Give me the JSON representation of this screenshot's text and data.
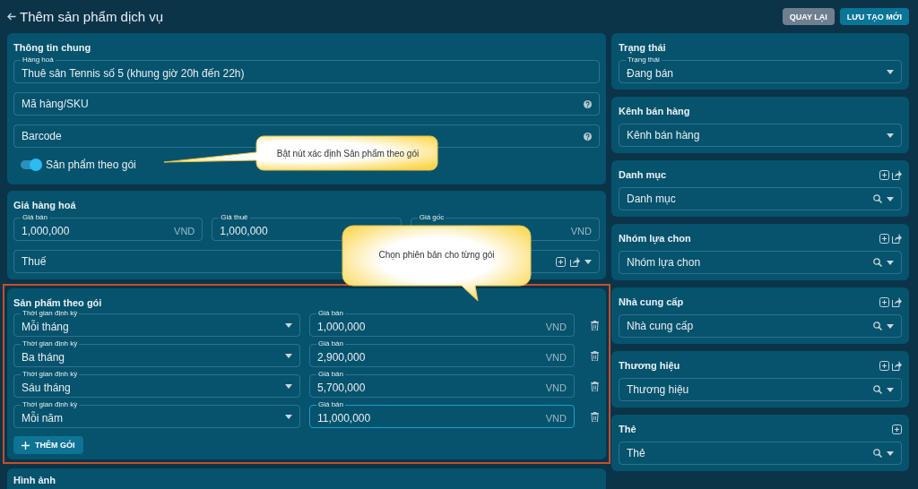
{
  "header": {
    "title": "Thêm sản phẩm dịch vụ",
    "buttons": [
      {
        "label": "QUAY LẠI",
        "kind": "secondary"
      },
      {
        "label": "LƯU TẠO MỚI",
        "kind": "primary"
      }
    ]
  },
  "general": {
    "title": "Thông tin chung",
    "fields": [
      {
        "label": "Hàng hoá",
        "value": "Thuê sân Tennis số 5 (khung giờ 20h đến 22h)"
      },
      {
        "placeholder": "Mã hàng/SKU",
        "help": true
      },
      {
        "placeholder": "Barcode",
        "help": true
      }
    ],
    "toggle": {
      "label": "Sản phẩm theo gói",
      "on": true
    }
  },
  "pricing": {
    "title": "Giá hàng hoá",
    "fields": [
      {
        "label": "Giá bán",
        "value": "1,000,000",
        "unit": "VND"
      },
      {
        "label": "Giá thuê",
        "value": "1,000,000"
      },
      {
        "label": "Giá gốc",
        "unit": "VND"
      }
    ],
    "tax": {
      "placeholder": "Thuế",
      "add": true,
      "share": true
    }
  },
  "packages": {
    "title": "Sản phẩm theo gói",
    "highlighted": true,
    "rows": [
      {
        "period_label": "Thời gian định kỳ",
        "period": "Mỗi tháng",
        "price_label": "Giá bán",
        "price": "1,000,000",
        "unit": "VND",
        "focused": false
      },
      {
        "period_label": "Thời gian định kỳ",
        "period": "Ba tháng",
        "price_label": "Giá bán",
        "price": "2,900,000",
        "unit": "VND",
        "focused": false
      },
      {
        "period_label": "Thời gian định kỳ",
        "period": "Sáu tháng",
        "price_label": "Giá bán",
        "price": "5,700,000",
        "unit": "VND",
        "focused": false
      },
      {
        "period_label": "Thời gian định kỳ",
        "period": "Mỗi năm",
        "price_label": "Giá bán",
        "price": "11,000,000",
        "unit": "VND",
        "focused": true
      }
    ],
    "add_button": "THÊM GÓI"
  },
  "images": {
    "title": "Hình ảnh"
  },
  "sidebar": [
    {
      "title": "Trạng thái",
      "field": {
        "label": "Trạng thái",
        "value": "Đang bán"
      }
    },
    {
      "title": "Kênh bán hàng",
      "field": {
        "placeholder": "Kênh bán hàng"
      }
    },
    {
      "title": "Danh mục",
      "field": {
        "placeholder": "Danh mục"
      },
      "add": true,
      "share": true,
      "search": true
    },
    {
      "title": "Nhóm lựa chon",
      "field": {
        "placeholder": "Nhóm lựa chon"
      },
      "add": true,
      "share": true,
      "search": true
    },
    {
      "title": "Nhà cung cấp",
      "field": {
        "placeholder": "Nhà cung cấp"
      },
      "add": true,
      "share": true,
      "search": true
    },
    {
      "title": "Thương hiệu",
      "field": {
        "placeholder": "Thương hiệu"
      },
      "add": true,
      "share": true,
      "search": true
    },
    {
      "title": "Thẻ",
      "field": {
        "placeholder": "Thẻ"
      },
      "add": true,
      "search": true
    }
  ],
  "callouts": [
    {
      "text": "Bật nút xác định Sản phẩm theo gói",
      "kind": "leftward"
    },
    {
      "text": "Chọn phiên bản cho từng gói",
      "kind": "downward"
    }
  ]
}
